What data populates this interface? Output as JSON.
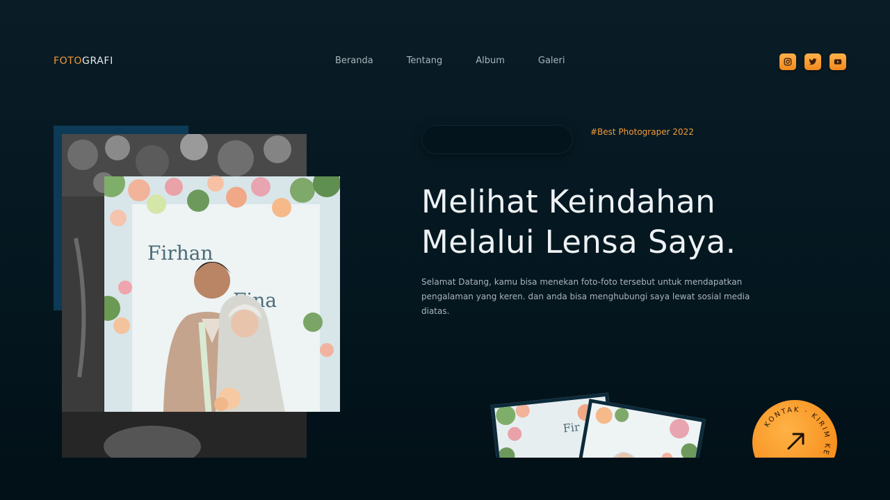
{
  "logo": {
    "accent": "FOTO",
    "rest": "GRAFI"
  },
  "nav": {
    "items": [
      "Beranda",
      "Tentang",
      "Album",
      "Galeri"
    ]
  },
  "social": [
    "instagram-icon",
    "twitter-icon",
    "youtube-icon"
  ],
  "hero": {
    "tag": "#Best Photograper 2022",
    "headline_line1": "Melihat Keindahan",
    "headline_line2": "Melalui Lensa Saya.",
    "description": "Selamat Datang, kamu bisa menekan foto-foto tersebut untuk mendapatkan pengalaman yang keren. dan anda bisa menghubungi saya lewat sosial media diatas."
  },
  "photo": {
    "name_left": "Firhan",
    "name_right": "Fina"
  },
  "badge": {
    "text": "KONTAK · KIRIM KE EMAIL · ",
    "icon": "arrow-up-right-icon"
  },
  "colors": {
    "accent": "#f29b38",
    "background": "#061821"
  }
}
